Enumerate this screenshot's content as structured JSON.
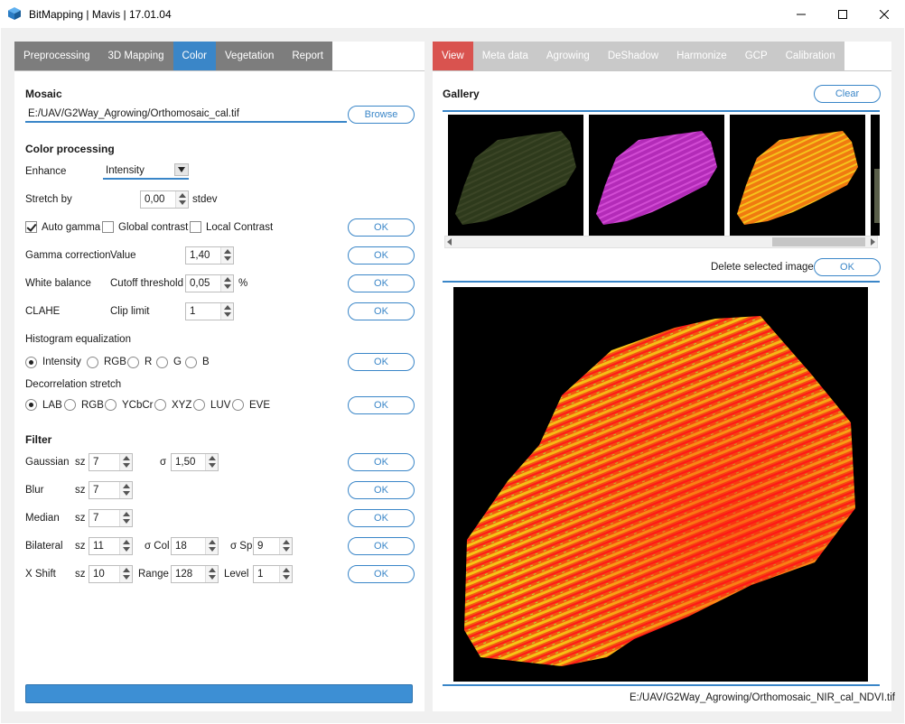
{
  "window": {
    "title": "BitMapping | Mavis | 17.01.04"
  },
  "left_tabs": [
    "Preprocessing",
    "3D Mapping",
    "Color",
    "Vegetation",
    "Report"
  ],
  "left_active_tab": "Color",
  "mosaic": {
    "heading": "Mosaic",
    "path": "E:/UAV/G2Way_Agrowing/Orthomosaic_cal.tif",
    "browse_label": "Browse"
  },
  "color": {
    "heading": "Color processing",
    "enhance_label": "Enhance",
    "enhance_value": "Intensity",
    "stretch_label": "Stretch by",
    "stretch_value": "0,00",
    "stretch_unit": "stdev",
    "auto_gamma": {
      "label": "Auto gamma",
      "checked": true
    },
    "global_contrast": {
      "label": "Global contrast",
      "checked": false
    },
    "local_contrast": {
      "label": "Local Contrast",
      "checked": false
    },
    "gamma_label": "Gamma correction",
    "gamma_value_label": "Value",
    "gamma_value": "1,40",
    "wb_label": "White balance",
    "wb_cutoff_label": "Cutoff threshold",
    "wb_value": "0,05",
    "wb_unit": "%",
    "clahe_label": "CLAHE",
    "clahe_clip_label": "Clip limit",
    "clahe_value": "1",
    "hist_label": "Histogram equalization",
    "hist_options": [
      "Intensity",
      "RGB",
      "R",
      "G",
      "B"
    ],
    "hist_selected": "Intensity",
    "decor_label": "Decorrelation stretch",
    "decor_options": [
      "LAB",
      "RGB",
      "YCbCr",
      "XYZ",
      "LUV",
      "EVE"
    ],
    "decor_selected": "LAB",
    "ok_label": "OK"
  },
  "filter": {
    "heading": "Filter",
    "gaussian": {
      "label": "Gaussian",
      "sz_label": "sz",
      "sz": "7",
      "sigma_label": "σ",
      "sigma": "1,50"
    },
    "blur": {
      "label": "Blur",
      "sz_label": "sz",
      "sz": "7"
    },
    "median": {
      "label": "Median",
      "sz_label": "sz",
      "sz": "7"
    },
    "bilateral": {
      "label": "Bilateral",
      "sz_label": "sz",
      "sz": "11",
      "col_label": "σ Col",
      "col": "18",
      "sp_label": "σ Sp",
      "sp": "9"
    },
    "xshift": {
      "label": "X Shift",
      "sz_label": "sz",
      "sz": "10",
      "range_label": "Range",
      "range": "128",
      "level_label": "Level",
      "level": "1"
    }
  },
  "right_tabs": [
    "View",
    "Meta data",
    "Agrowing",
    "DeShadow",
    "Harmonize",
    "GCP",
    "Calibration"
  ],
  "right_active_tab": "View",
  "gallery": {
    "heading": "Gallery",
    "clear_label": "Clear",
    "delete_label": "Delete selected images",
    "ok_label": "OK"
  },
  "status": {
    "path": "E:/UAV/G2Way_Agrowing/Orthomosaic_NIR_cal_NDVI.tif"
  },
  "colors": {
    "accent": "#3a86c8",
    "tab_gray": "#7d7d7d",
    "active_red": "#d9534f"
  }
}
